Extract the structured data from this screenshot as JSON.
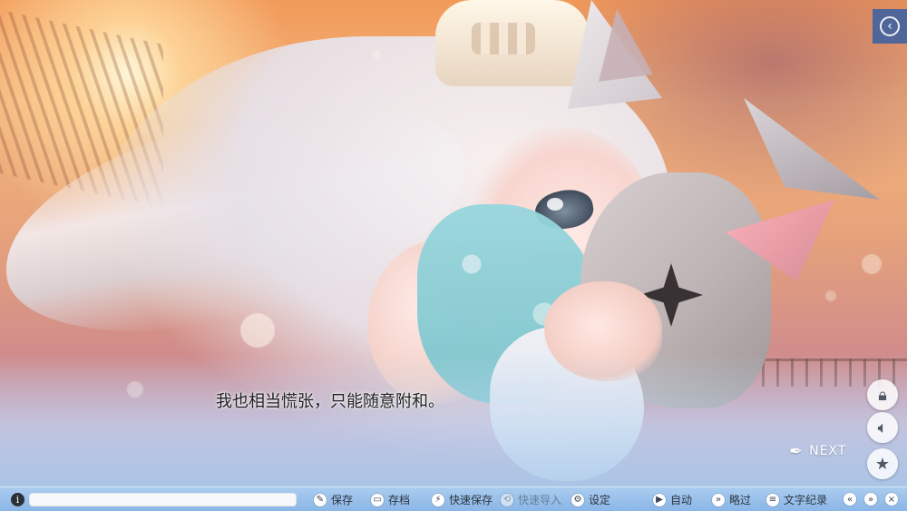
{
  "scene": {
    "dialogue": "我也相当慌张，只能随意附和。",
    "next_label": "NEXT"
  },
  "side_buttons": {
    "lock_icon": "lock-icon",
    "sound_icon": "speaker-icon",
    "star_icon": "star-icon"
  },
  "top": {
    "back_icon": "back-icon"
  },
  "toolbar": {
    "info_icon": "info-icon",
    "progress": 0.0,
    "save": "保存",
    "load": "存档",
    "quick_save": "快速保存",
    "quick_load": "快速导入",
    "settings": "设定",
    "auto": "自动",
    "skip": "略过",
    "log": "文字纪录",
    "icons": {
      "save": "pencil-icon",
      "load": "folder-icon",
      "quick_save": "quick-save-icon",
      "quick_load": "quick-load-icon",
      "settings": "gear-icon",
      "auto": "play-icon",
      "skip": "fast-forward-icon",
      "log": "log-icon",
      "nav_back": "rewind-icon",
      "nav_forward": "forward-icon",
      "nav_close": "close-icon"
    }
  },
  "colors": {
    "toolbar": "#9cc3ea",
    "back_button": "#375fa5"
  }
}
